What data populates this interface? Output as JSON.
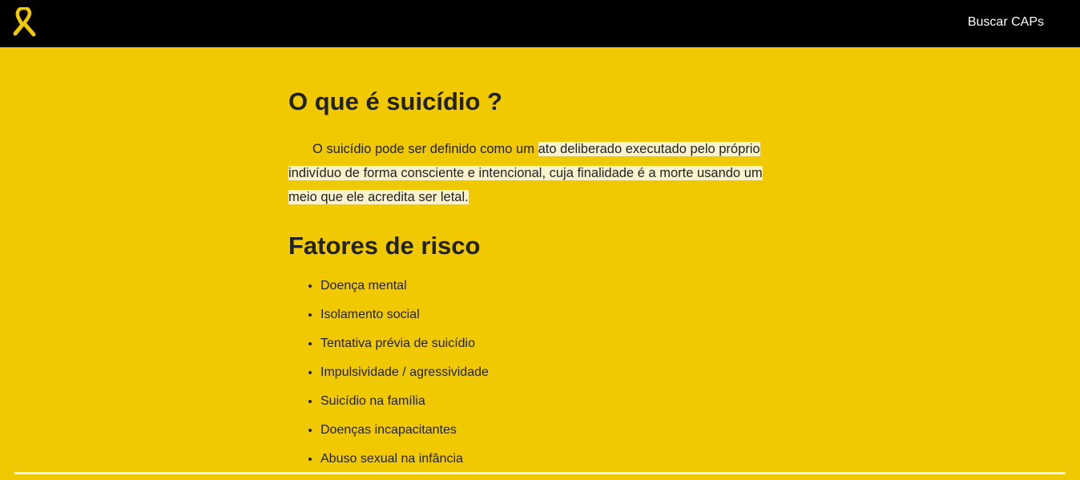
{
  "navbar": {
    "logo_icon": "awareness-ribbon-icon",
    "logo_color": "#f1c900",
    "link_label": "Buscar CAPs"
  },
  "section1": {
    "title": "O que é suicídio ?",
    "text_plain": "O suicídio pode ser definido como um ",
    "text_highlight": "ato deliberado executado pelo próprio indivíduo de forma consciente e intencional, cuja finalidade é a morte usando um meio que ele acredita ser letal."
  },
  "section2": {
    "title": "Fatores de risco",
    "items": [
      "Doença mental",
      "Isolamento social",
      "Tentativa prévia de suicídio",
      "Impulsividade / agressividade",
      "Suicídio na família",
      "Doenças incapacitantes",
      "Abuso sexual na infância"
    ]
  },
  "colors": {
    "background": "#f1c900",
    "navbar": "#000000",
    "highlight": "#fcf2cc"
  }
}
